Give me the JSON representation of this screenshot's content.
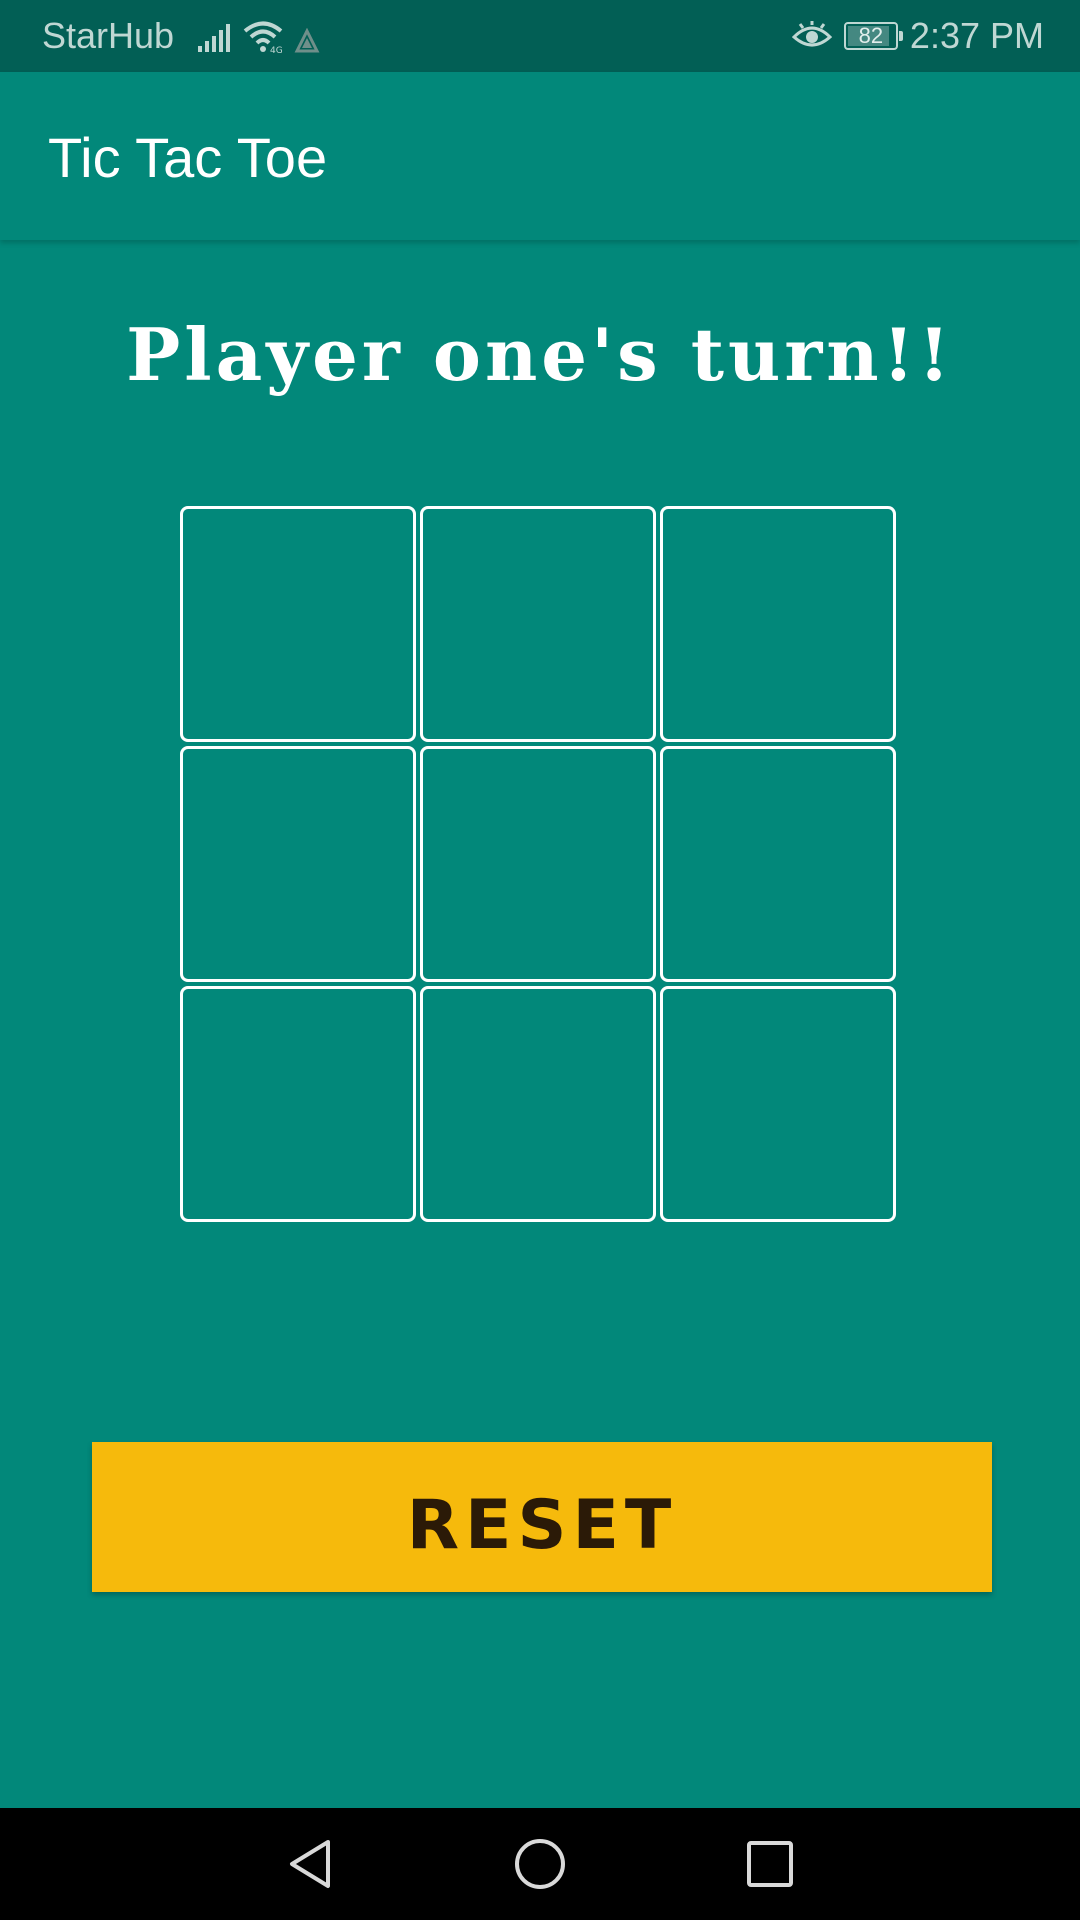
{
  "status_bar": {
    "carrier": "StarHub",
    "time": "2:37 PM",
    "battery_level": "82",
    "icons": [
      "signal-icon",
      "wifi-icon",
      "data-icon",
      "eye-comfort-icon",
      "battery-icon"
    ]
  },
  "app_bar": {
    "title": "Tic Tac Toe"
  },
  "game": {
    "turn_text": "Player one's turn!!",
    "board": [
      "",
      "",
      "",
      "",
      "",
      "",
      "",
      "",
      ""
    ]
  },
  "reset_button": {
    "label": "RESET"
  },
  "nav_bar": {
    "icons": [
      "back-icon",
      "home-icon",
      "recents-icon"
    ]
  },
  "colors": {
    "background": "#02887A",
    "status_bar": "#025F55",
    "accent_button": "#F6BA0C",
    "button_text": "#2B1A07",
    "grid_lines": "#FFFFFF"
  }
}
